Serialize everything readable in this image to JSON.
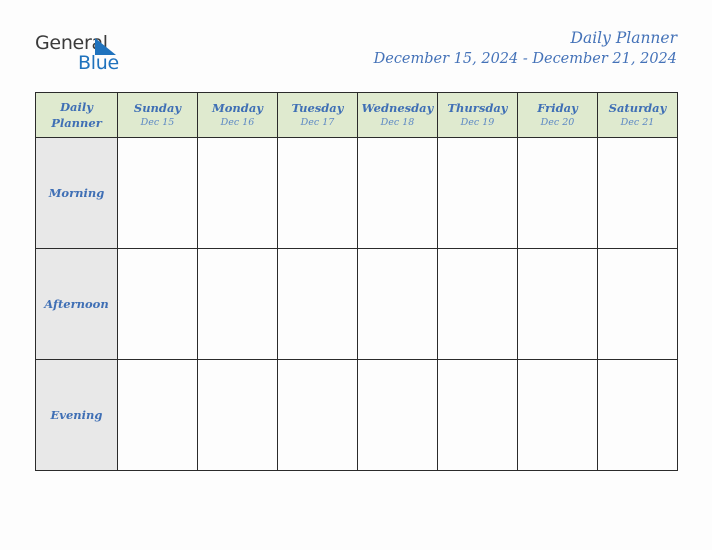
{
  "brand": {
    "logo_text_1": "General",
    "logo_text_2": "Blue",
    "logo_triangle_icon": "triangle-icon",
    "colors": {
      "logo_dark": "#3b3b3b",
      "logo_blue": "#1f72bd",
      "accent_blue": "#4472b8",
      "header_green": "#dfeacf",
      "row_label_gray": "#e8e8e8",
      "border": "#2b2b2b"
    }
  },
  "header": {
    "title": "Daily Planner",
    "date_range": "December 15, 2024 - December 21, 2024"
  },
  "table": {
    "corner": {
      "line1": "Daily",
      "line2": "Planner"
    },
    "columns": [
      {
        "day": "Sunday",
        "date": "Dec 15"
      },
      {
        "day": "Monday",
        "date": "Dec 16"
      },
      {
        "day": "Tuesday",
        "date": "Dec 17"
      },
      {
        "day": "Wednesday",
        "date": "Dec 18"
      },
      {
        "day": "Thursday",
        "date": "Dec 19"
      },
      {
        "day": "Friday",
        "date": "Dec 20"
      },
      {
        "day": "Saturday",
        "date": "Dec 21"
      }
    ],
    "rows": [
      {
        "label": "Morning",
        "cells": [
          "",
          "",
          "",
          "",
          "",
          "",
          ""
        ]
      },
      {
        "label": "Afternoon",
        "cells": [
          "",
          "",
          "",
          "",
          "",
          "",
          ""
        ]
      },
      {
        "label": "Evening",
        "cells": [
          "",
          "",
          "",
          "",
          "",
          "",
          ""
        ]
      }
    ]
  }
}
